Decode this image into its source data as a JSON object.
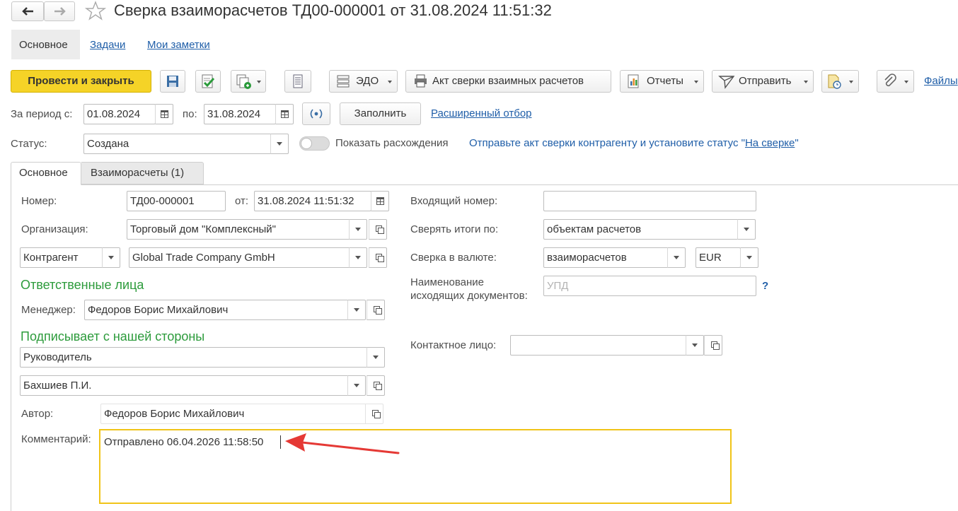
{
  "window": {
    "title": "Сверка взаиморасчетов ТД00-000001 от 31.08.2024 11:51:32"
  },
  "nav": {
    "tabs": [
      "Основное",
      "Задачи",
      "Мои заметки"
    ]
  },
  "toolbar": {
    "post_close": "Провести и закрыть",
    "edo": "ЭДО",
    "act": "Акт сверки взаимных расчетов",
    "reports": "Отчеты",
    "send": "Отправить",
    "files": "Файлы"
  },
  "period": {
    "from_label": "За период с:",
    "from": "01.08.2024",
    "to_label": "по:",
    "to": "31.08.2024",
    "fill": "Заполнить",
    "advanced": "Расширенный отбор"
  },
  "status": {
    "label": "Статус:",
    "value": "Создана",
    "toggle_label": "Показать расхождения",
    "hint_prefix": "Отправьте акт сверки контрагенту и установите статус \"",
    "hint_link": "На сверке",
    "hint_suffix": "\""
  },
  "form_tabs": [
    "Основное",
    "Взаиморасчеты (1)"
  ],
  "left": {
    "number_label": "Номер:",
    "number": "ТД00-000001",
    "date_label": "от:",
    "date": "31.08.2024 11:51:32",
    "org_label": "Организация:",
    "org": "Торговый дом \"Комплексный\"",
    "party_type": "Контрагент",
    "party": "Global Trade Company GmbH",
    "responsible_header": "Ответственные лица",
    "manager_label": "Менеджер:",
    "manager": "Федоров Борис Михайлович",
    "signer_header": "Подписывает с нашей стороны",
    "signer_role": "Руководитель",
    "signer_name": "Бахшиев П.И.",
    "author_label": "Автор:",
    "author": "Федоров Борис Михайлович",
    "comment_label": "Комментарий:",
    "comment": "Отправлено 06.04.2026 11:58:50"
  },
  "right": {
    "incoming_label": "Входящий номер:",
    "incoming": "",
    "totals_label": "Сверять итоги по:",
    "totals": "объектам расчетов",
    "currency_label": "Сверка в валюте:",
    "currency_mode": "взаиморасчетов",
    "currency": "EUR",
    "docname_label_1": "Наименование",
    "docname_label_2": "исходящих документов:",
    "docname_placeholder": "УПД",
    "help": "?",
    "contact_label": "Контактное лицо:",
    "contact": ""
  },
  "colors": {
    "primary_button": "#f5d327",
    "link": "#1f5ea8",
    "section_header": "#2c9b3b",
    "focus_border": "#f0c419",
    "annotation_arrow": "#e53935"
  }
}
